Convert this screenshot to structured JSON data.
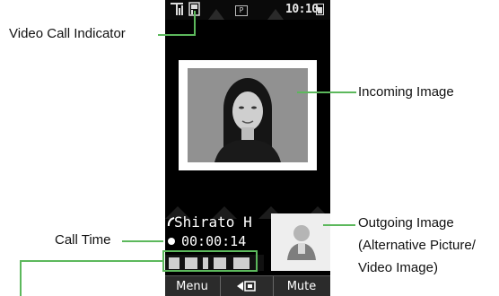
{
  "status_bar": {
    "time": "10:10",
    "p_badge": "P",
    "icons": [
      "signal-icon",
      "video-call-indicator-icon",
      "battery-icon"
    ]
  },
  "call": {
    "caller_name": "Shirato H",
    "call_time": "00:00:14"
  },
  "softkeys": {
    "left": "Menu",
    "middle_icon": "camera-switch-icon",
    "right": "Mute"
  },
  "annotations": {
    "video_call_indicator": "Video Call Indicator",
    "incoming_image": "Incoming Image",
    "call_time": "Call Time",
    "outgoing_image_line1": "Outgoing Image",
    "outgoing_image_line2": "(Alternative Picture/",
    "outgoing_image_line3": "Video Image)"
  },
  "colors": {
    "callout": "#5cb85c",
    "screen_bg": "#000000",
    "softkey_bg": "#2b2b2b"
  }
}
